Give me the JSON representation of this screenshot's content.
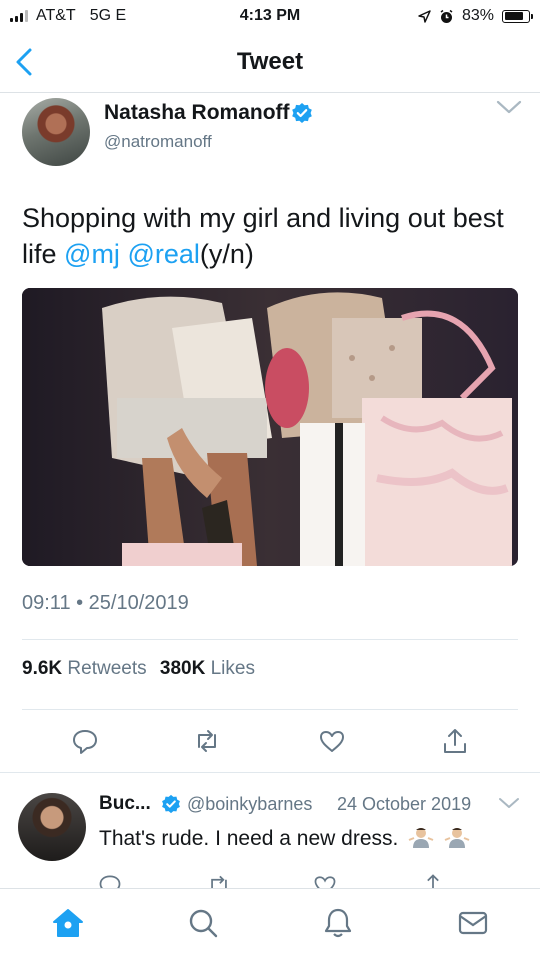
{
  "status_bar": {
    "carrier": "AT&T",
    "network": "5G E",
    "time": "4:13 PM",
    "battery": "83%",
    "battery_level": 0.83
  },
  "nav": {
    "title": "Tweet"
  },
  "tweet": {
    "author_name": "Natasha Romanoff",
    "author_handle": "@natromanoff",
    "text_parts": [
      "Shopping with my girl and living out best life ",
      "@mj",
      " ",
      "@real",
      "(y/n)"
    ],
    "timestamp": "09:11 • 25/10/2019",
    "retweets_count": "9.6K",
    "retweets_label": "Retweets",
    "likes_count": "380K",
    "likes_label": "Likes"
  },
  "reply": {
    "name": "Buc...",
    "handle": "@boinkybarnes",
    "date": "24 October 2019",
    "text": "That's rude. I need a new dress."
  },
  "icons": {
    "actions": [
      "reply-icon",
      "retweet-icon",
      "like-icon",
      "share-icon"
    ],
    "tabs": [
      "home-icon",
      "search-icon",
      "notifications-icon",
      "messages-icon"
    ]
  },
  "colors": {
    "accent": "#1da1f2",
    "secondary_text": "#657786",
    "divider": "#e1e8ed"
  }
}
